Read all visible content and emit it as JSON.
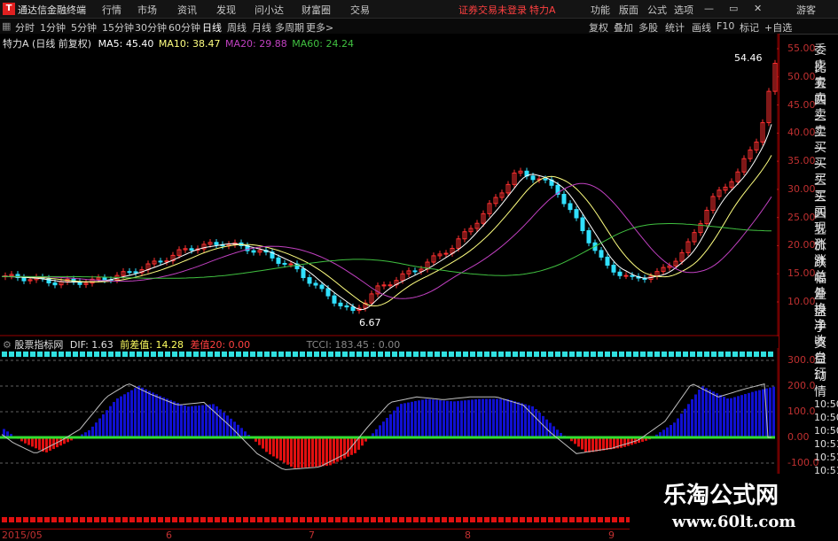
{
  "menubar": {
    "app_title": "通达信金融终端",
    "menus": [
      "行情",
      "市场",
      "资讯",
      "发现",
      "问小达",
      "财富圈",
      "交易"
    ],
    "login_status": "证券交易未登录",
    "stock_name": "特力A",
    "right_menus": [
      "功能",
      "版面",
      "公式",
      "选项"
    ],
    "user": "游客"
  },
  "periodbar": {
    "periods": [
      "分时",
      "1分钟",
      "5分钟",
      "15分钟",
      "30分钟",
      "60分钟",
      "日线",
      "周线",
      "月线",
      "多周期",
      "更多>"
    ],
    "selected": "日线",
    "tools": [
      "复权",
      "叠加",
      "多股",
      "统计",
      "画线",
      "F10",
      "标记",
      "+自选"
    ]
  },
  "main_info": {
    "title": "特力A (日线 前复权)",
    "ma5": "MA5: 45.40",
    "ma10": "MA10: 38.47",
    "ma20": "MA20: 29.88",
    "ma60": "MA60: 24.24",
    "high_label": "54.46",
    "low_label": "6.67"
  },
  "price_axis": [
    "55.00",
    "50.00",
    "45.00",
    "40.00",
    "35.00",
    "30.00",
    "25.00",
    "20.00",
    "15.00",
    "10.00"
  ],
  "indicator": {
    "name": "股票指标网",
    "dif": "DIF: 1.63",
    "prev": "前差值: 14.28",
    "diff": "差值20: 0.00",
    "tcci": "TCCI: 183.45 : 0.00",
    "axis": [
      "300.0",
      "200.0",
      "100.0",
      "0.00",
      "-100.0"
    ]
  },
  "date_axis": [
    "2015/05",
    "6",
    "7",
    "8",
    "9"
  ],
  "right_panel": [
    "委比",
    "卖五",
    "卖四",
    "卖三",
    "卖二",
    "卖一",
    "买一",
    "买二",
    "买三",
    "买四",
    "买五",
    "现价",
    "涨跌",
    "涨幅",
    "总量",
    "外盘",
    "换手",
    "净资",
    "收益",
    "自动",
    "行情"
  ],
  "right_times": [
    "10:50",
    "10:50",
    "10:50",
    "10:51",
    "10:51",
    "10:51"
  ],
  "watermark": {
    "line1": "乐淘公式网",
    "line2": "www.60lt.com"
  },
  "colors": {
    "up": "#ff3030",
    "down": "#30e0ff",
    "ma5": "#ffffff",
    "ma10": "#ffff80",
    "ma20": "#c040c0",
    "ma60": "#40c040",
    "dif_blue": "#1010d0",
    "dif_red": "#e01010"
  }
}
